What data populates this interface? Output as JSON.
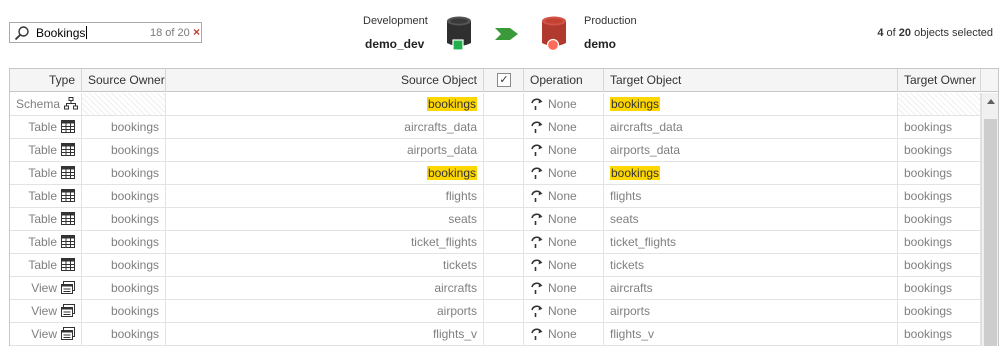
{
  "search": {
    "value": "Bookings",
    "counter": "18 of 20",
    "clear_glyph": "×"
  },
  "source_db": {
    "label": "Development",
    "name": "demo_dev",
    "icon": "database-icon",
    "status_color": "#22b14c"
  },
  "target_db": {
    "label": "Production",
    "name": "demo",
    "icon": "database-icon",
    "status_color": "#ff6b5a"
  },
  "direction_color": "#3a9a3a",
  "selection": {
    "selected": "4",
    "of": "of",
    "total": "20",
    "suffix": "objects selected"
  },
  "columns": {
    "type": "Type",
    "source_owner": "Source Owner",
    "source_object": "Source Object",
    "check": "✓",
    "operation": "Operation",
    "target_object": "Target Object",
    "target_owner": "Target Owner"
  },
  "rows": [
    {
      "type": "Schema",
      "icon": "schema",
      "source_owner": "",
      "source_object": "bookings",
      "highlight": true,
      "operation": "None",
      "target_object": "bookings",
      "target_owner": ""
    },
    {
      "type": "Table",
      "icon": "table",
      "source_owner": "bookings",
      "source_object": "aircrafts_data",
      "highlight": false,
      "operation": "None",
      "target_object": "aircrafts_data",
      "target_owner": "bookings"
    },
    {
      "type": "Table",
      "icon": "table",
      "source_owner": "bookings",
      "source_object": "airports_data",
      "highlight": false,
      "operation": "None",
      "target_object": "airports_data",
      "target_owner": "bookings"
    },
    {
      "type": "Table",
      "icon": "table",
      "source_owner": "bookings",
      "source_object": "bookings",
      "highlight": true,
      "operation": "None",
      "target_object": "bookings",
      "target_owner": "bookings"
    },
    {
      "type": "Table",
      "icon": "table",
      "source_owner": "bookings",
      "source_object": "flights",
      "highlight": false,
      "operation": "None",
      "target_object": "flights",
      "target_owner": "bookings"
    },
    {
      "type": "Table",
      "icon": "table",
      "source_owner": "bookings",
      "source_object": "seats",
      "highlight": false,
      "operation": "None",
      "target_object": "seats",
      "target_owner": "bookings"
    },
    {
      "type": "Table",
      "icon": "table",
      "source_owner": "bookings",
      "source_object": "ticket_flights",
      "highlight": false,
      "operation": "None",
      "target_object": "ticket_flights",
      "target_owner": "bookings"
    },
    {
      "type": "Table",
      "icon": "table",
      "source_owner": "bookings",
      "source_object": "tickets",
      "highlight": false,
      "operation": "None",
      "target_object": "tickets",
      "target_owner": "bookings"
    },
    {
      "type": "View",
      "icon": "view",
      "source_owner": "bookings",
      "source_object": "aircrafts",
      "highlight": false,
      "operation": "None",
      "target_object": "aircrafts",
      "target_owner": "bookings"
    },
    {
      "type": "View",
      "icon": "view",
      "source_owner": "bookings",
      "source_object": "airports",
      "highlight": false,
      "operation": "None",
      "target_object": "airports",
      "target_owner": "bookings"
    },
    {
      "type": "View",
      "icon": "view",
      "source_owner": "bookings",
      "source_object": "flights_v",
      "highlight": false,
      "operation": "None",
      "target_object": "flights_v",
      "target_owner": "bookings"
    }
  ]
}
